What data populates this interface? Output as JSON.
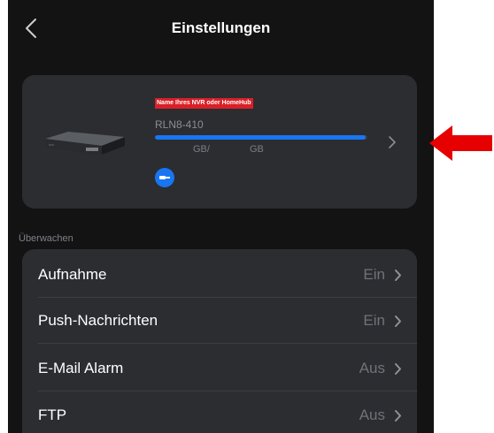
{
  "header": {
    "title": "Einstellungen",
    "back_icon": "chevron-left-icon"
  },
  "device_card": {
    "name_label": "Name Ihres NVR oder HomeHub",
    "model": "RLN8-410",
    "storage": {
      "used_text": "GB/",
      "total_text": "GB",
      "fill_fraction": 0.99,
      "bar_color": "#1976f2"
    },
    "connection_icon": "network-cable-icon",
    "chevron_icon": "chevron-right-icon"
  },
  "section": {
    "label": "Überwachen"
  },
  "settings": [
    {
      "label": "Aufnahme",
      "value": "Ein"
    },
    {
      "label": "Push-Nachrichten",
      "value": "Ein"
    },
    {
      "label": "E-Mail Alarm",
      "value": "Aus"
    },
    {
      "label": "FTP",
      "value": "Aus"
    }
  ],
  "annotation": {
    "arrow_color": "#e60000"
  },
  "colors": {
    "background": "#131313",
    "card": "#2b2d31",
    "accent": "#1976f2"
  }
}
